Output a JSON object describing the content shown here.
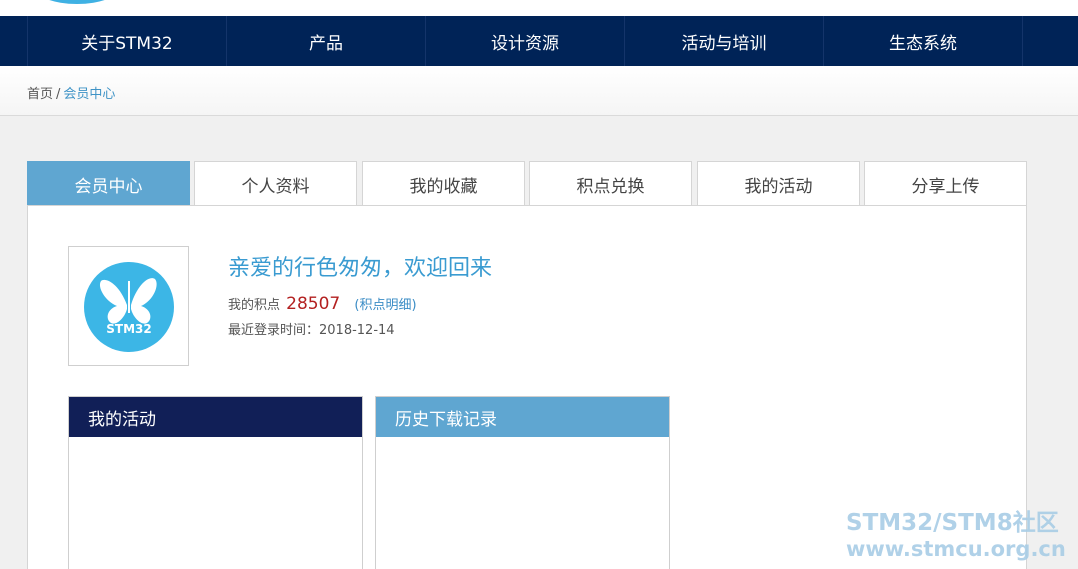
{
  "nav": {
    "items": [
      "关于STM32",
      "产品",
      "设计资源",
      "活动与培训",
      "生态系统"
    ]
  },
  "breadcrumb": {
    "home": "首页",
    "separator": "/",
    "current": "会员中心"
  },
  "tabs": [
    {
      "label": "会员中心",
      "active": true
    },
    {
      "label": "个人资料",
      "active": false
    },
    {
      "label": "我的收藏",
      "active": false
    },
    {
      "label": "积点兑换",
      "active": false
    },
    {
      "label": "我的活动",
      "active": false
    },
    {
      "label": "分享上传",
      "active": false
    }
  ],
  "profile": {
    "welcome": "亲爱的行色匆匆，欢迎回来",
    "points_label": "我的积点",
    "points_value": "28507",
    "points_link": "(积点明细)",
    "last_login_label": "最近登录时间：",
    "last_login_value": "2018-12-14",
    "avatar_text": "STM32"
  },
  "sections": {
    "activity_title": "我的活动",
    "download_title": "历史下载记录"
  },
  "watermark": {
    "line1": "STM32/STM8社区",
    "line2": "www.stmcu.org.cn"
  },
  "colors": {
    "nav_bg": "#002357",
    "tab_active": "#5fa6d1",
    "accent_blue": "#3a9bd1",
    "points_red": "#b32020",
    "activity_head": "#111f57"
  }
}
